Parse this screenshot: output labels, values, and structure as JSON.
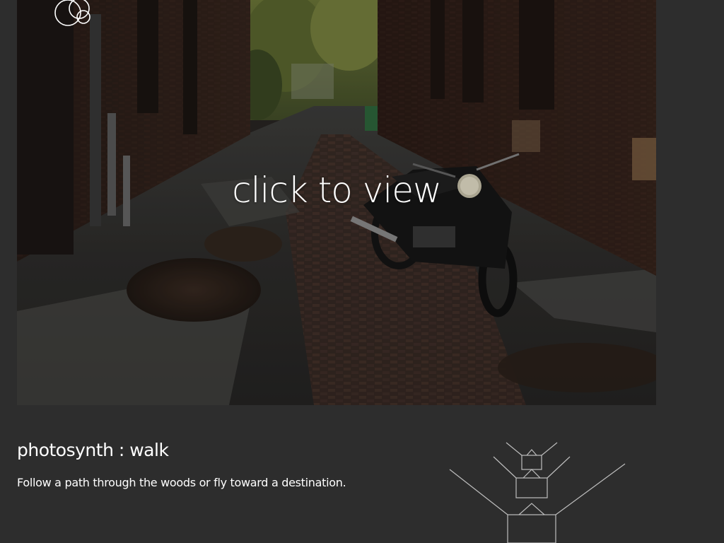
{
  "viewer": {
    "overlay_text": "click to view",
    "logo_icon": "photosynth-rings-icon",
    "image_subject": "alley-motorcycle-photo"
  },
  "info": {
    "title": "photosynth : walk",
    "description": "Follow a path through the woods or fly toward a destination.",
    "illustration_icon": "walk-cameras-icon"
  },
  "colors": {
    "background": "#2d2d2d",
    "text": "#ffffff",
    "line_art": "#bdbdbd"
  }
}
